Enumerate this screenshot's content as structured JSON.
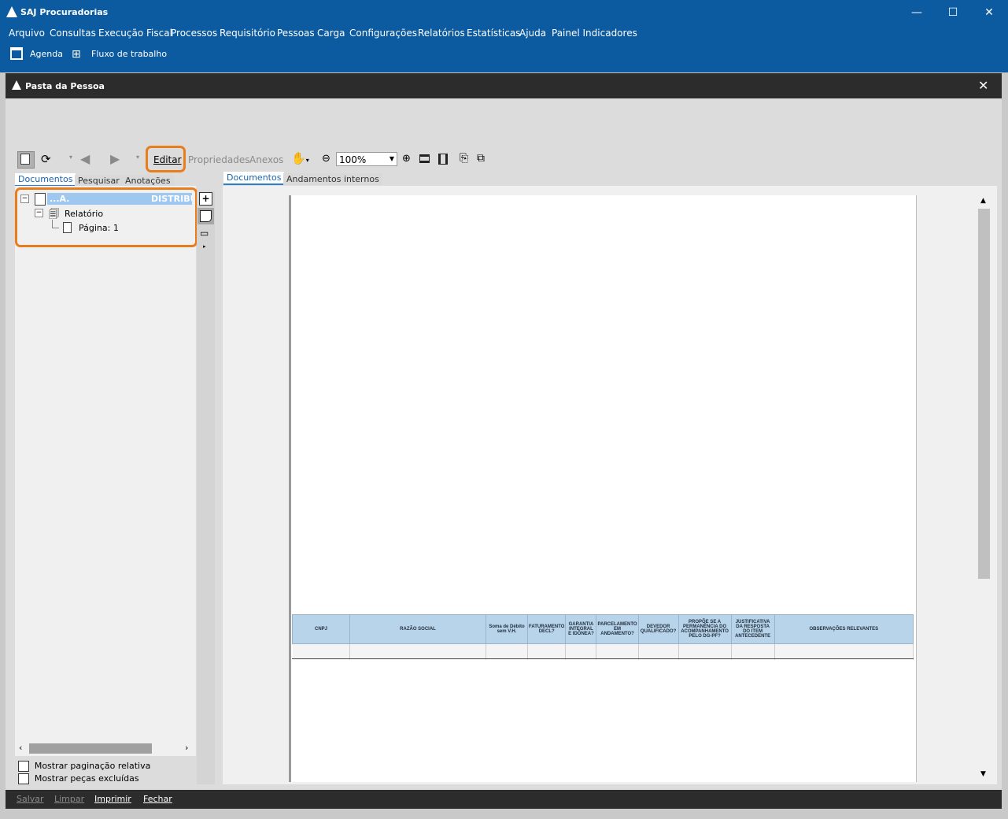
{
  "app": {
    "title": "SAJ Procuradorias",
    "window_buttons": {
      "minimize": "—",
      "maximize": "☐",
      "close": "✕"
    }
  },
  "menu": [
    "Arquivo",
    "Consultas",
    "Execução Fiscal",
    "Processos",
    "Requisitório",
    "Pessoas",
    "Carga",
    "Configurações",
    "Relatórios",
    "Estatísticas",
    "Ajuda",
    "Painel Indicadores"
  ],
  "top_toolbar": {
    "agenda": "Agenda",
    "workflow": "Fluxo de trabalho"
  },
  "inner_window": {
    "title": "Pasta da Pessoa",
    "close": "✕"
  },
  "toolbar": {
    "edit": "Editar",
    "properties": "Propriedades",
    "attachments": "Anexos",
    "zoom": "100%"
  },
  "left_tabs": [
    "Documentos",
    "Pesquisar",
    "Anotações"
  ],
  "right_tabs": [
    "Documentos",
    "Andamentos internos"
  ],
  "tree": {
    "root_label": "...A.",
    "root_right": "DISTRIBUI",
    "child": "Relatório",
    "page": "Página: 1"
  },
  "options": {
    "relative_pagination": "Mostrar paginação relativa",
    "show_excluded": "Mostrar peças excluídas"
  },
  "report_table": {
    "headers": [
      "CNPJ",
      "RAZÃO SOCIAL",
      "Soma de Débito sem V.H.",
      "FATURAMENTO DECL?",
      "GARANTIA INTEGRAL E IDÔNEA?",
      "PARCELAMENTO EM ANDAMENTO?",
      "DEVEDOR QUALIFICADO?",
      "PROPÕE SE A PERMANÊNCIA DO ACOMPANHAMENTO PELO DG-PF?",
      "JUSTIFICATIVA DA RESPOSTA DO ITEM ANTECEDENTE",
      "OBSERVAÇÕES RELEVANTES"
    ]
  },
  "bottom_buttons": {
    "save": "Salvar",
    "clear": "Limpar",
    "print": "Imprimir",
    "close": "Fechar"
  },
  "colors": {
    "title_bar": "#0c5aa0",
    "highlight": "#e87d1e",
    "table_header": "#b8d4ea"
  }
}
